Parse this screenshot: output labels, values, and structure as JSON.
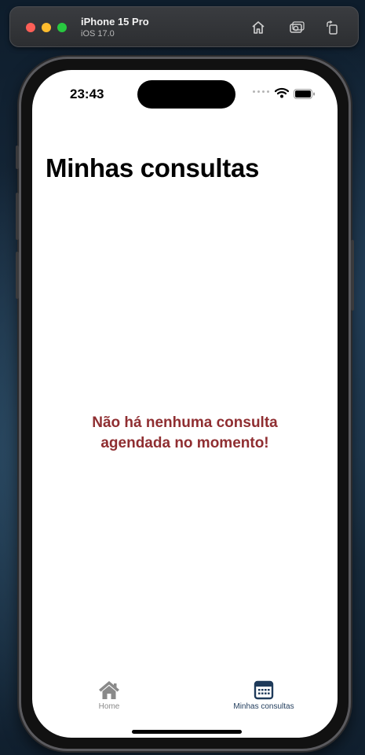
{
  "simulator": {
    "device_name": "iPhone 15 Pro",
    "os_version": "iOS 17.0",
    "buttons": [
      {
        "icon": "home-icon"
      },
      {
        "icon": "screenshot-icon"
      },
      {
        "icon": "rotate-icon"
      }
    ]
  },
  "status_bar": {
    "time": "23:43",
    "icons": [
      "cellular-dots-icon",
      "wifi-icon",
      "battery-icon"
    ]
  },
  "page": {
    "title": "Minhas consultas",
    "empty_message": "Não há nenhuma consulta agendada no momento!"
  },
  "tab_bar": {
    "tabs": [
      {
        "label": "Home",
        "icon": "house-icon",
        "selected": false
      },
      {
        "label": "Minhas consultas",
        "icon": "calendar-icon",
        "selected": true
      }
    ]
  },
  "colors": {
    "accent": "#1e3a5a",
    "empty_text": "#8f2e31",
    "inactive_tab": "#8a8a8a"
  }
}
